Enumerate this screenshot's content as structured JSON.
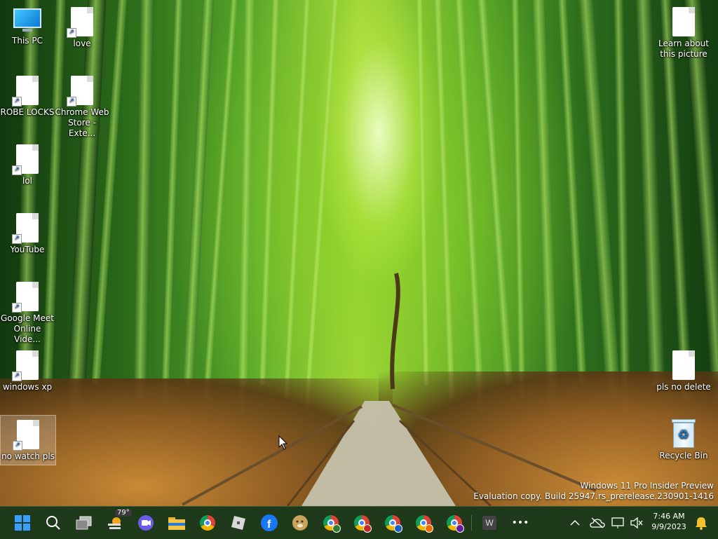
{
  "desktop": {
    "icons_left": [
      {
        "label": "This PC",
        "type": "computer"
      },
      {
        "label": "love",
        "type": "shortcut"
      },
      {
        "label": "ROBE LOCKS",
        "type": "shortcut"
      },
      {
        "label": "Chrome Web Store - Exte...",
        "type": "shortcut"
      },
      {
        "label": "lol",
        "type": "shortcut"
      },
      {
        "label": "YouTube",
        "type": "shortcut"
      },
      {
        "label": "Google Meet Online Vide...",
        "type": "shortcut"
      },
      {
        "label": "windows xp",
        "type": "shortcut"
      },
      {
        "label": "no watch pls",
        "type": "shortcut",
        "selected": true
      }
    ],
    "icons_right": [
      {
        "label": "Learn about this picture",
        "type": "file"
      },
      {
        "label": "pls no delete",
        "type": "file"
      },
      {
        "label": "Recycle Bin",
        "type": "recycle-bin"
      }
    ]
  },
  "watermark": {
    "line1": "Windows 11 Pro Insider Preview",
    "line2": "Evaluation copy. Build 25947.rs_prerelease.230901-1416"
  },
  "taskbar": {
    "weather_temp": "79°",
    "apps": [
      {
        "name": "start-button-icon",
        "color": "#1e90ff"
      },
      {
        "name": "search-icon"
      },
      {
        "name": "task-view-icon"
      },
      {
        "name": "weather-widget-icon"
      },
      {
        "name": "zoom-icon",
        "color": "#7b68ee"
      },
      {
        "name": "file-explorer-icon",
        "color": "#f4c542"
      },
      {
        "name": "chrome-icon"
      },
      {
        "name": "roblox-icon",
        "color": "#cfcfcf"
      },
      {
        "name": "facebook-icon",
        "color": "#1877f2"
      },
      {
        "name": "doge-icon",
        "color": "#c7a45a"
      },
      {
        "name": "chrome-profile-icon",
        "color": "#2e7d32"
      },
      {
        "name": "chrome-profile-icon",
        "color": "#c62828"
      },
      {
        "name": "chrome-profile-icon",
        "color": "#1565c0"
      },
      {
        "name": "chrome-profile-icon",
        "color": "#ef6c00"
      },
      {
        "name": "chrome-profile-icon",
        "color": "#6a1b9a"
      },
      {
        "name": "word-icon",
        "letter": "W"
      },
      {
        "name": "more-apps-icon",
        "glyph": "•••"
      }
    ],
    "tray": {
      "chevron": "^",
      "time": "7:46 AM",
      "date": "9/9/2023"
    }
  }
}
